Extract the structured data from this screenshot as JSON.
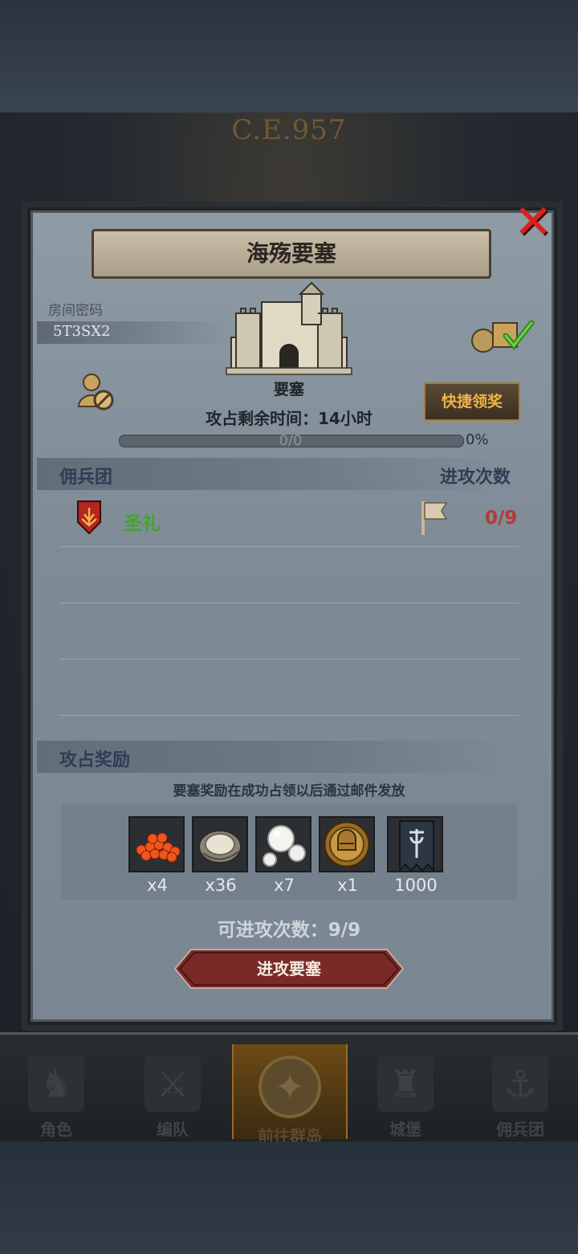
{
  "era": "C.E.957",
  "dialog": {
    "title": "海殇要塞",
    "room_code_label": "房间密码",
    "room_code": "5T3SX2",
    "fortress_caption": "要塞",
    "quick_claim": "快捷领奖",
    "time_remaining": "攻占剩余时间：14小时",
    "progress_text": "0/0",
    "progress_percent": "0%",
    "progress_value": 0,
    "mercenary_header": "佣兵团",
    "attack_count_header": "进攻次数",
    "guilds": [
      {
        "name": "圣礼",
        "attacks": "0/9"
      }
    ],
    "rewards_label": "攻占奖励",
    "rewards_note": "要塞奖励在成功占领以后通过邮件发放",
    "rewards": [
      {
        "icon": "salmon-roe-icon",
        "qty": "x4"
      },
      {
        "icon": "oyster-icon",
        "qty": "x36"
      },
      {
        "icon": "pearls-icon",
        "qty": "x7"
      },
      {
        "icon": "knight-medal-icon",
        "qty": "x1"
      },
      {
        "icon": "guild-banner-icon",
        "qty": "1000"
      }
    ],
    "attacks_available": "可进攻次数：9/9",
    "attack_button": "进攻要塞"
  },
  "nav": [
    {
      "label": "角色",
      "icon": "character-icon"
    },
    {
      "label": "编队",
      "icon": "formation-icon"
    },
    {
      "label": "前往群岛",
      "icon": "islands-icon",
      "active": true
    },
    {
      "label": "城堡",
      "icon": "castle-icon"
    },
    {
      "label": "佣兵团",
      "icon": "mercenary-icon"
    }
  ],
  "colors": {
    "close": "#d8231c",
    "guild_name": "#3fa62b",
    "attack_count": "#b33a36",
    "quick_claim_text": "#f1b347",
    "attack_button": "#7a2a26"
  }
}
